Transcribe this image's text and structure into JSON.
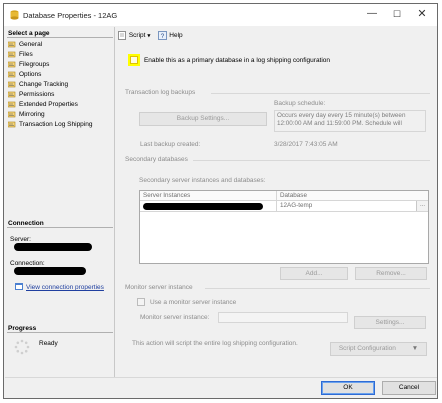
{
  "window": {
    "title": "Database Properties - 12AG",
    "minimize": "—",
    "maximize": "☐",
    "close": "✕"
  },
  "left_panel": {
    "select_page_header": "Select a page",
    "pages": [
      "General",
      "Files",
      "Filegroups",
      "Options",
      "Change Tracking",
      "Permissions",
      "Extended Properties",
      "Mirroring",
      "Transaction Log Shipping"
    ],
    "connection_header": "Connection",
    "server_label": "Server:",
    "connection_label": "Connection:",
    "view_connection_properties": "View connection properties",
    "progress_header": "Progress",
    "progress_status": "Ready"
  },
  "toolbar": {
    "script_label": "Script",
    "help_label": "Help"
  },
  "primary": {
    "enable_label": "Enable this as a primary database in a log shipping configuration",
    "enabled": false
  },
  "transaction_log_backups": {
    "group_label": "Transaction log backups",
    "backup_schedule_label": "Backup schedule:",
    "backup_settings_button": "Backup Settings...",
    "schedule_text": "Occurs every day every 15 minute(s) between 12:00:00 AM and 11:59:00 PM. Schedule will",
    "last_backup_label": "Last backup created:",
    "last_backup_value": "3/28/2017 7:43:05 AM"
  },
  "secondary_databases": {
    "group_label": "Secondary databases",
    "grid_label": "Secondary server instances and databases:",
    "columns": [
      "Server Instances",
      "Database"
    ],
    "rows": [
      {
        "server": "",
        "database": "12AG-temp"
      }
    ],
    "ellipsis": "...",
    "add_button": "Add...",
    "remove_button": "Remove..."
  },
  "monitor": {
    "group_label": "Monitor server instance",
    "use_monitor_label": "Use a monitor server instance",
    "monitor_instance_label": "Monitor server instance:",
    "settings_button": "Settings..."
  },
  "script_config": {
    "note": "This action will script the entire log shipping configuration.",
    "button": "Script Configuration",
    "dropdown": "▼"
  },
  "footer": {
    "ok": "OK",
    "cancel": "Cancel"
  },
  "colors": {
    "highlight": "#ffff00",
    "link": "#1f3f9f",
    "panel_bg": "#f0f0f0"
  }
}
